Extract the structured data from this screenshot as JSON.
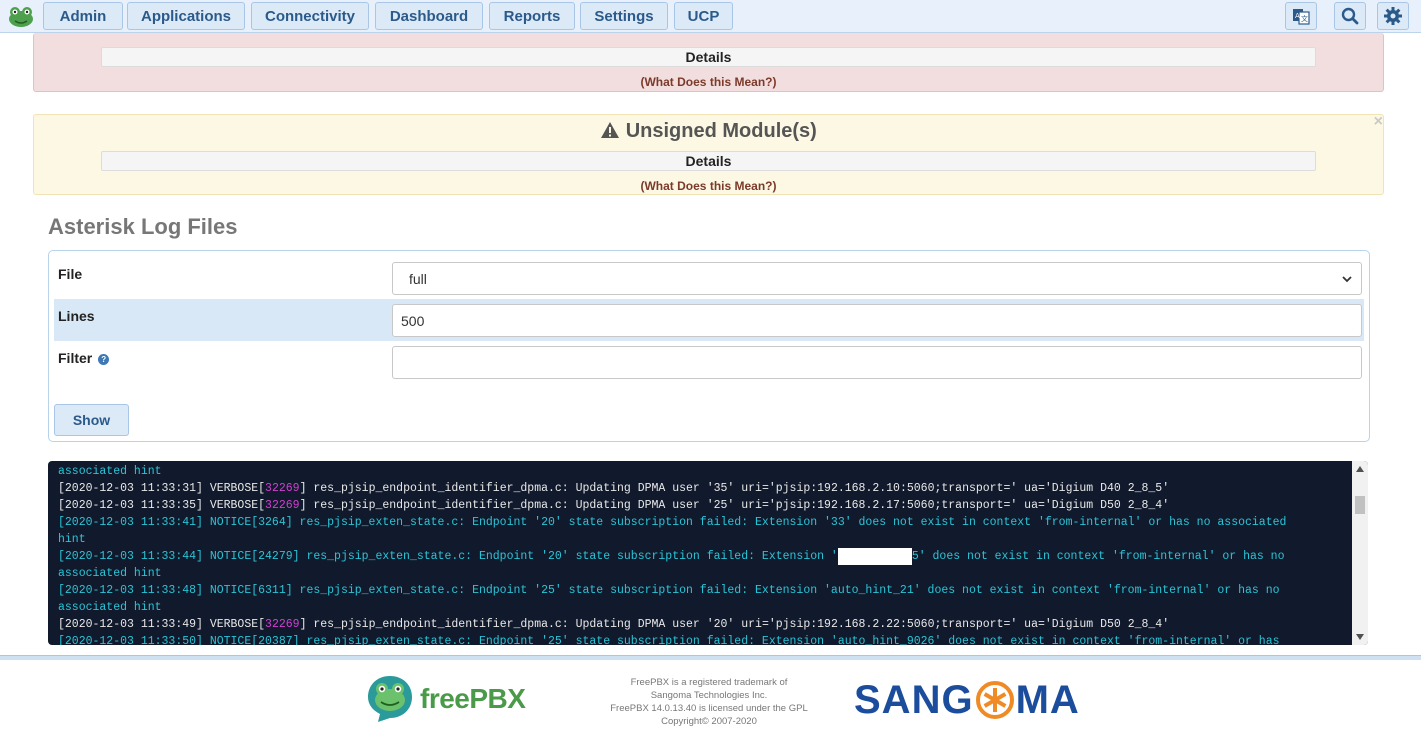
{
  "nav": {
    "items": [
      {
        "label": "Admin"
      },
      {
        "label": "Applications"
      },
      {
        "label": "Connectivity"
      },
      {
        "label": "Dashboard"
      },
      {
        "label": "Reports"
      },
      {
        "label": "Settings"
      },
      {
        "label": "UCP"
      }
    ],
    "icons": [
      "language-icon",
      "search-icon",
      "gear-icon"
    ]
  },
  "alerts": [
    {
      "title": "",
      "details": "Details",
      "what": "(What Does this Mean?)",
      "color": "#f2dede"
    },
    {
      "title": "Unsigned Module(s)",
      "details": "Details",
      "what": "(What Does this Mean?)",
      "color": "#fcf8e3",
      "close": "×"
    }
  ],
  "section": {
    "title": "Asterisk Log Files"
  },
  "form": {
    "file_label": "File",
    "file_value": "full",
    "lines_label": "Lines",
    "lines_value": "500",
    "filter_label": "Filter",
    "filter_help": "?",
    "filter_value": "",
    "show_label": "Show"
  },
  "log": [
    {
      "segments": [
        {
          "c": "cyan",
          "t": "associated hint"
        }
      ]
    },
    {
      "segments": [
        {
          "c": "white",
          "t": "[2020-12-03 11:33:31] VERBOSE["
        },
        {
          "c": "mag",
          "t": "32269"
        },
        {
          "c": "white",
          "t": "] res_pjsip_endpoint_identifier_dpma.c: Updating DPMA user '35' uri='pjsip:192.168.2.10:5060;transport=' ua='Digium D40 2_8_5'"
        }
      ]
    },
    {
      "segments": [
        {
          "c": "white",
          "t": "[2020-12-03 11:33:35] VERBOSE["
        },
        {
          "c": "mag",
          "t": "32269"
        },
        {
          "c": "white",
          "t": "] res_pjsip_endpoint_identifier_dpma.c: Updating DPMA user '25' uri='pjsip:192.168.2.17:5060;transport=' ua='Digium D50 2_8_4'"
        }
      ]
    },
    {
      "segments": [
        {
          "c": "cyan",
          "t": "[2020-12-03 11:33:41] NOTICE[3264] res_pjsip_exten_state.c: Endpoint '20' state subscription failed: Extension '33' does not exist in context 'from-internal' or has no associated"
        }
      ]
    },
    {
      "segments": [
        {
          "c": "cyan",
          "t": "hint"
        }
      ]
    },
    {
      "segments": [
        {
          "c": "cyan",
          "t": "[2020-12-03 11:33:44] NOTICE[24279] res_pjsip_exten_state.c: Endpoint '20' state subscription failed: Extension '"
        },
        {
          "c": "redact",
          "t": ""
        },
        {
          "c": "cyan",
          "t": "5' does not exist in context 'from-internal' or has no"
        }
      ]
    },
    {
      "segments": [
        {
          "c": "cyan",
          "t": "associated hint"
        }
      ]
    },
    {
      "segments": [
        {
          "c": "cyan",
          "t": "[2020-12-03 11:33:48] NOTICE[6311] res_pjsip_exten_state.c: Endpoint '25' state subscription failed: Extension 'auto_hint_21' does not exist in context 'from-internal' or has no"
        }
      ]
    },
    {
      "segments": [
        {
          "c": "cyan",
          "t": "associated hint"
        }
      ]
    },
    {
      "segments": [
        {
          "c": "white",
          "t": "[2020-12-03 11:33:49] VERBOSE["
        },
        {
          "c": "mag",
          "t": "32269"
        },
        {
          "c": "white",
          "t": "] res_pjsip_endpoint_identifier_dpma.c: Updating DPMA user '20' uri='pjsip:192.168.2.22:5060;transport=' ua='Digium D50 2_8_4'"
        }
      ]
    },
    {
      "segments": [
        {
          "c": "cyan",
          "t": "[2020-12-03 11:33:50] NOTICE[20387] res_pjsip_exten_state.c: Endpoint '25' state subscription failed: Extension 'auto_hint_9026' does not exist in context 'from-internal' or has"
        }
      ]
    }
  ],
  "footer": {
    "line1": "FreePBX is a registered trademark of",
    "line2": "Sangoma Technologies Inc.",
    "line3": "FreePBX 14.0.13.40 is licensed under the GPL",
    "line4": "Copyright© 2007-2020",
    "freepbx_word": "freePBX",
    "sangoma_left": "SANG",
    "sangoma_right": "MA"
  }
}
